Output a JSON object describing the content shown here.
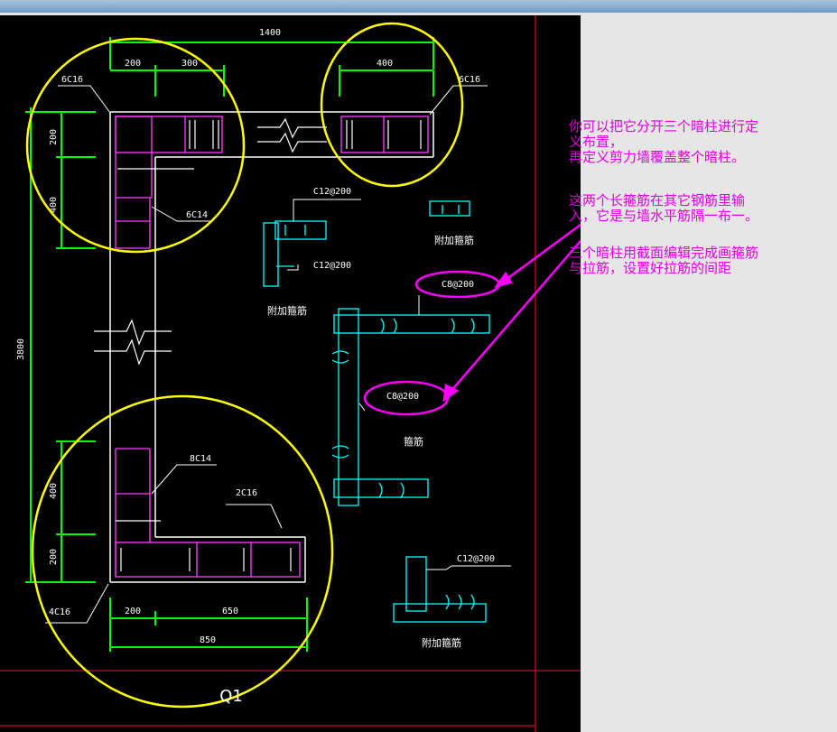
{
  "dims": {
    "top_total": "1400",
    "top_left_1": "200",
    "top_left_2": "300",
    "top_right": "400",
    "left_total": "3800",
    "left_top_1": "200",
    "left_top_2": "400",
    "left_bottom_1": "400",
    "left_bottom_2": "200",
    "bottom_1": "200",
    "bottom_2": "650",
    "bottom_total": "850"
  },
  "rebar_labels": {
    "top_left_corner": "6C16",
    "top_right_end": "6C16",
    "left_upper_mid": "6C14",
    "left_lower_mid": "8C14",
    "bottom_end": "2C16",
    "bottom_left_corner": "4C16"
  },
  "stirrups": {
    "c12_a": "C12@200",
    "c12_b": "C12@200",
    "c12_c": "C12@200",
    "c8_a": "C8@200",
    "c8_b": "C8@200",
    "extra_1": "附加箍筋",
    "extra_2": "附加箍筋",
    "extra_3": "附加箍筋",
    "hoop": "箍筋"
  },
  "drawing_title": "Q1",
  "notes": {
    "note1_line1": "你可以把它分开三个暗柱进行定",
    "note1_line2": "义布置，",
    "note1_line3": "再定义剪力墙覆盖整个暗柱。",
    "note2_line1": "这两个长箍筋在其它钢筋里输",
    "note2_line2": "入，它是与墙水平筋隔一布一。",
    "note3_line1": "三个暗柱用截面编辑完成画箍筋",
    "note3_line2": "与拉筋，设置好拉筋的间距"
  },
  "colors": {
    "background": "#000000",
    "dimension": "#00ff00",
    "circle": "#ffff00",
    "wall": "#ffffff",
    "stirrup": "#ff40ff",
    "detail": "#00ffff",
    "annotation": "#e000e0",
    "frame": "#ff0040"
  }
}
